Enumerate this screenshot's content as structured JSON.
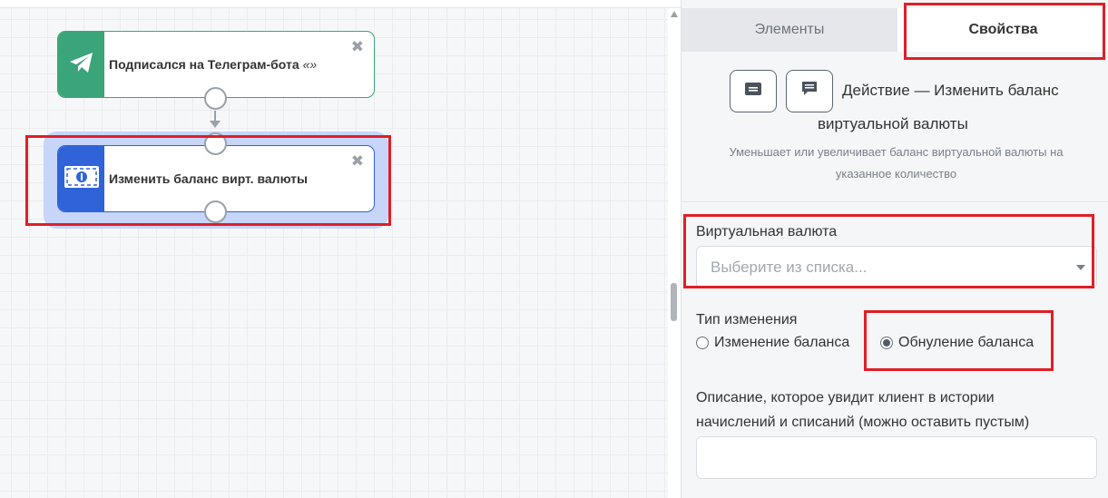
{
  "canvas": {
    "nodes": [
      {
        "title": "Подписался на Телеграм-бота",
        "quote": "«»",
        "icon": "telegram-icon",
        "color": "#3aa57a"
      },
      {
        "title": "Изменить баланс вирт. валюты",
        "icon": "money-icon",
        "color": "#2f63d7"
      }
    ],
    "close_symbol": "✖"
  },
  "panel": {
    "tabs": [
      {
        "label": "Элементы",
        "active": false
      },
      {
        "label": "Свойства",
        "active": true
      }
    ],
    "action_title_line1": "Действие — Изменить баланс",
    "action_title_line2": "виртуальной валюты",
    "action_description": "Уменьшает или увеличивает баланс виртуальной валюты на указанное количество",
    "header_buttons": [
      "card-icon",
      "comment-icon"
    ],
    "currency": {
      "label": "Виртуальная валюта",
      "placeholder": "Выберите из списка..."
    },
    "change_type": {
      "label": "Тип изменения",
      "options": [
        {
          "label": "Изменение баланса",
          "checked": false
        },
        {
          "label": "Обнуление баланса",
          "checked": true
        }
      ]
    },
    "description_field": {
      "label_line1": "Описание, которое увидит клиент в истории",
      "label_line2": "начислений и списаний (можно оставить пустым)",
      "value": ""
    }
  },
  "colors": {
    "accent_green": "#3aa57a",
    "accent_blue": "#2f63d7",
    "highlight_red": "#e01e26"
  }
}
